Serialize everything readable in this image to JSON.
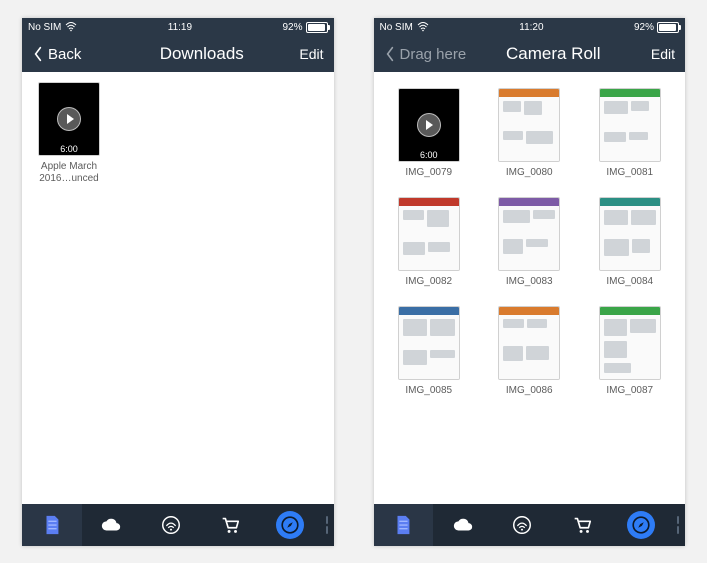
{
  "left": {
    "status": {
      "carrier": "No SIM",
      "time": "11:19",
      "battery_pct": "92%"
    },
    "nav": {
      "back_label": "Back",
      "title": "Downloads",
      "edit_label": "Edit"
    },
    "item": {
      "duration": "6:00",
      "title": "Apple March 2016…unced"
    }
  },
  "right": {
    "status": {
      "carrier": "No SIM",
      "time": "11:20",
      "battery_pct": "92%"
    },
    "nav": {
      "back_label": "Drag here",
      "title": "Camera Roll",
      "edit_label": "Edit"
    },
    "items": [
      {
        "name": "IMG_0079",
        "kind": "video",
        "duration": "6:00"
      },
      {
        "name": "IMG_0080",
        "kind": "app"
      },
      {
        "name": "IMG_0081",
        "kind": "app"
      },
      {
        "name": "IMG_0082",
        "kind": "app"
      },
      {
        "name": "IMG_0083",
        "kind": "app"
      },
      {
        "name": "IMG_0084",
        "kind": "app"
      },
      {
        "name": "IMG_0085",
        "kind": "app"
      },
      {
        "name": "IMG_0086",
        "kind": "app"
      },
      {
        "name": "IMG_0087",
        "kind": "app"
      }
    ]
  },
  "tabs": {
    "files_icon": "files-icon",
    "cloud_icon": "cloud-icon",
    "wifi_icon": "wifi-share-icon",
    "cart_icon": "cart-icon",
    "browser_icon": "compass-icon"
  },
  "colors": {
    "accent": "#2e7cf6",
    "bar_bg": "#2b3847",
    "tab_bg": "#1f2935"
  }
}
